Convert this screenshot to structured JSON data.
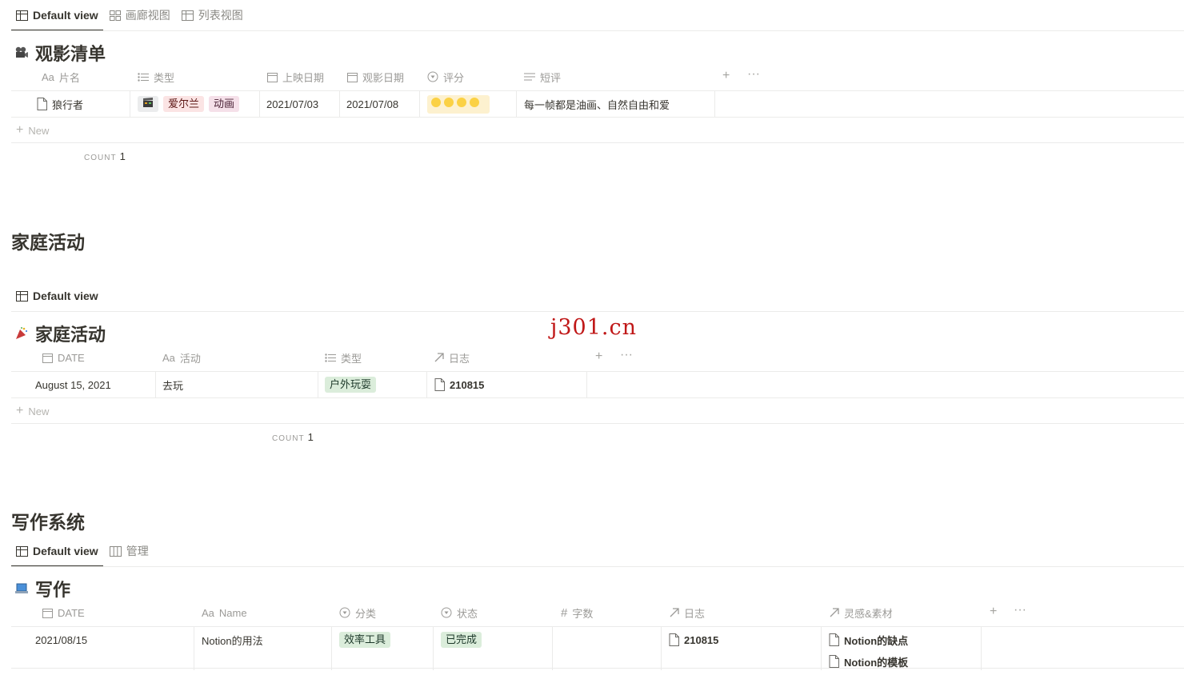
{
  "section1": {
    "tabs": [
      {
        "label": "Default view",
        "icon": "table-icon"
      },
      {
        "label": "画廊视图",
        "icon": "gallery-icon"
      },
      {
        "label": "列表视图",
        "icon": "table-icon"
      }
    ],
    "title": "观影清单",
    "title_icon": "film-camera-icon",
    "columns": [
      "片名",
      "类型",
      "上映日期",
      "观影日期",
      "评分",
      "短评"
    ],
    "column_prefix_aa": "Aa",
    "row": {
      "name": "狼行者",
      "types": [
        "爱尔兰",
        "动画"
      ],
      "type_icon": "clapper-board-icon",
      "release": "2021/07/03",
      "watched": "2021/07/08",
      "rating": 4,
      "review": "每一帧都是油画、自然自由和爱"
    },
    "new_label": "New",
    "count_label": "COUNT",
    "count_value": "1"
  },
  "section2": {
    "heading": "家庭活动",
    "tabs": [
      {
        "label": "Default view",
        "icon": "table-icon"
      }
    ],
    "title": "家庭活动",
    "title_icon": "party-popper-icon",
    "columns": [
      "DATE",
      "活动",
      "类型",
      "日志"
    ],
    "column_prefix_aa": "Aa",
    "row": {
      "date": "August 15, 2021",
      "activity": "去玩",
      "type": "户外玩耍",
      "log": "210815"
    },
    "new_label": "New",
    "count_label": "COUNT",
    "count_value": "1"
  },
  "section3": {
    "heading": "写作系统",
    "tabs": [
      {
        "label": "Default view",
        "icon": "table-icon"
      },
      {
        "label": "管理",
        "icon": "board-icon"
      }
    ],
    "title": "写作",
    "title_icon": "laptop-icon",
    "columns": [
      "DATE",
      "Name",
      "分类",
      "状态",
      "字数",
      "日志",
      "灵感&素材"
    ],
    "column_prefix_aa": "Aa",
    "row": {
      "date": "2021/08/15",
      "name": "Notion的用法",
      "category": "效率工具",
      "status": "已完成",
      "words": "",
      "log": "210815",
      "materials": [
        "Notion的缺点",
        "Notion的模板"
      ]
    }
  },
  "watermark": "j301.cn",
  "colors": {
    "text": "#37352f",
    "muted": "#9b9a97",
    "border": "#ebebea",
    "tag_red_bg": "#fbe4e4",
    "tag_pink_bg": "#f5e0e9",
    "tag_green_bg": "#dbeddb",
    "tag_green_text": "#1c3829",
    "rating_yellow": "#fbd144",
    "watermark": "#c01818"
  }
}
